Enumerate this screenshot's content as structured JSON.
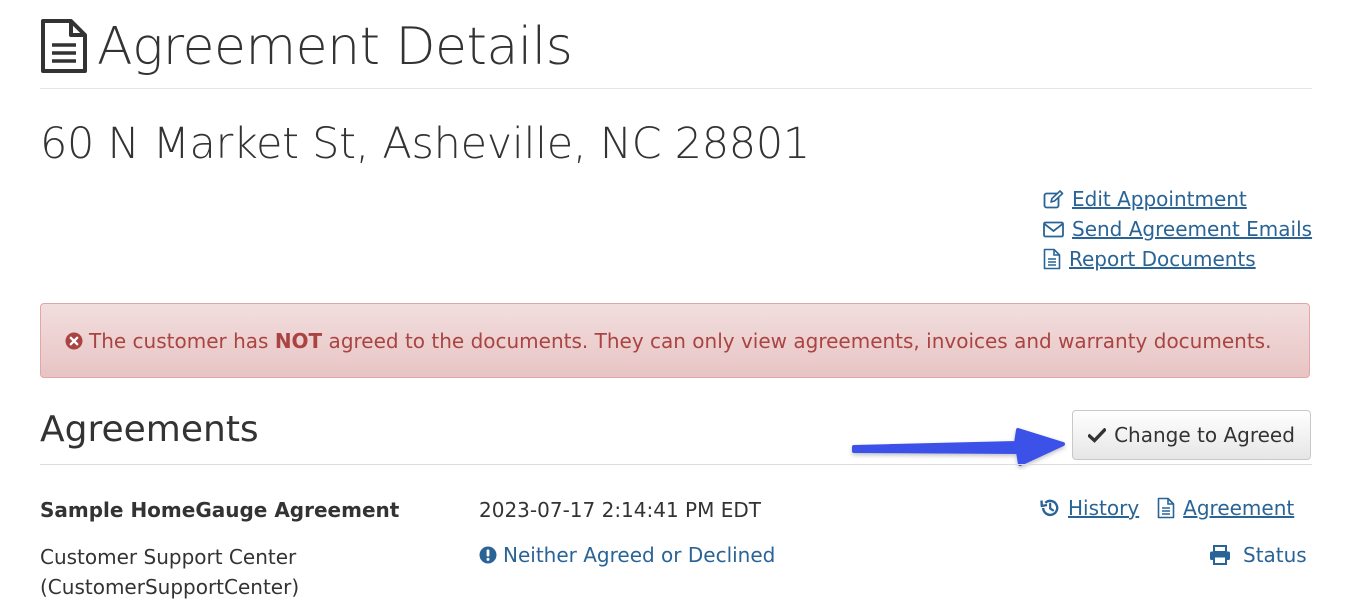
{
  "header": {
    "title": "Agreement Details",
    "icon": "document-icon"
  },
  "address": "60 N Market St, Asheville, NC 28801",
  "actions": [
    {
      "label": "Edit Appointment",
      "icon": "edit-icon"
    },
    {
      "label": "Send Agreement Emails",
      "icon": "envelope-icon"
    },
    {
      "label": "Report Documents",
      "icon": "document-icon"
    }
  ],
  "alert": {
    "icon": "times-circle-icon",
    "text_before": "The customer has ",
    "text_bold": "NOT",
    "text_after": " agreed to the documents. They can only view agreements, invoices and warranty documents.",
    "color": "#a94442",
    "background": "#f2dede"
  },
  "agreements": {
    "title": "Agreements",
    "change_button_label": "Change to Agreed",
    "change_button_icon": "check-icon",
    "arrow_color": "#3b51e8",
    "row": {
      "name": "Sample HomeGauge Agreement",
      "date": "2023-07-17 2:14:41 PM EDT",
      "history_label": "History",
      "agreement_label": "Agreement",
      "company_line1": "Customer Support Center",
      "company_line2": "(CustomerSupportCenter)",
      "status_label": "Neither Agreed or Declined",
      "status_icon": "exclamation-circle-icon",
      "print_label": "Status",
      "print_icon": "print-icon"
    }
  },
  "colors": {
    "link": "#2a6496",
    "text": "#333333"
  }
}
